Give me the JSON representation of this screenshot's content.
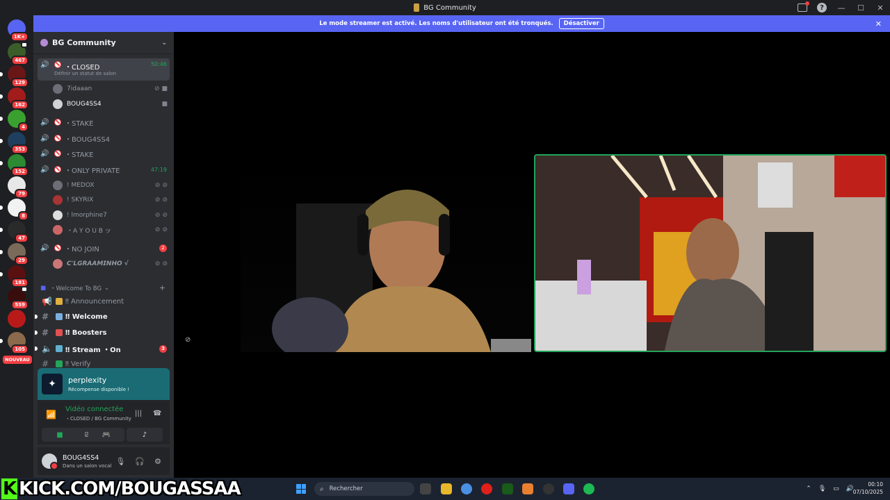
{
  "window": {
    "title": "BG Community"
  },
  "banner": {
    "text": "Le mode streamer est activé. Les noms d'utilisateur ont été tronqués.",
    "button": "Désactiver"
  },
  "guild_badges": [
    "1K+",
    "467",
    "129",
    "162",
    "4",
    "353",
    "152",
    "79",
    "8",
    "47",
    "29",
    "181",
    "559",
    "105"
  ],
  "nouveau": "NOUVEAU",
  "server": {
    "name": "BG Community"
  },
  "voice_channels": [
    {
      "name": "・CLOSED",
      "time": "50:46",
      "status": "Définir un statut de salon"
    },
    {
      "name": "・STAKE"
    },
    {
      "name": "・BOUG4SS4"
    },
    {
      "name": "・STAKE"
    },
    {
      "name": "・ONLY PRIVATE",
      "time": "47:19"
    },
    {
      "name": "・NO JOIN",
      "badge": "2"
    }
  ],
  "closed_users": [
    "7idaaan",
    "BOUG4SS4"
  ],
  "private_users": [
    "! MEDOX",
    "! SKYRIX",
    "! lmorphine7",
    "・A Y O U B ッ"
  ],
  "nojoin_users": [
    "𝘾'𝙇𝙂𝙍𝘼𝘼𝙈𝙄𝙉𝙃𝙊 √"
  ],
  "category": {
    "name": "・Welcome To BG"
  },
  "text_channels": [
    {
      "name": "‼ Announcement"
    },
    {
      "name": "‼ Welcome"
    },
    {
      "name": "‼ Boosters"
    },
    {
      "name": "‼ Stream ・On",
      "badge": "3"
    },
    {
      "name": "‼ Verify"
    }
  ],
  "promo": {
    "title": "perplexity",
    "subtitle": "Récompense disponible !"
  },
  "voice_status": {
    "title": "Vidéo connectée",
    "sub": "・CLOSED / BG Community"
  },
  "user_panel": {
    "name": "BOUG4SS4",
    "status": "Dans un salon vocal"
  },
  "overlay": {
    "kick_k": "K",
    "kick_text": "KICK.COM/BOUGASSAA"
  },
  "taskbar": {
    "search": "Rechercher",
    "time": "00:10",
    "date": "07/10/2025"
  },
  "colors": {
    "accent": "#5865f2",
    "green": "#23a55a",
    "red": "#f23f43",
    "kick": "#53fc18"
  }
}
